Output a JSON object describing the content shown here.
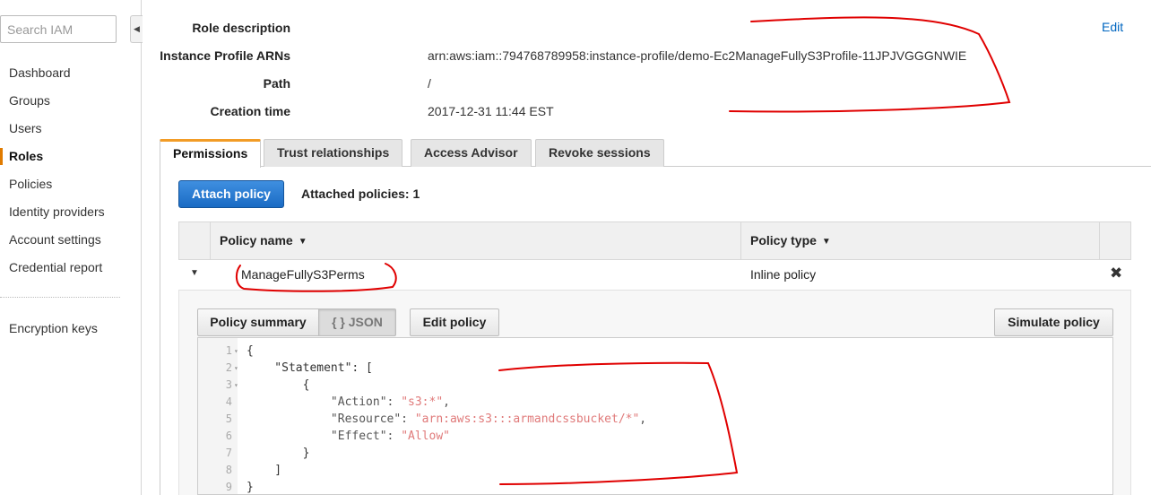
{
  "sidebar": {
    "search_placeholder": "Search IAM",
    "items": [
      {
        "label": "Dashboard"
      },
      {
        "label": "Groups"
      },
      {
        "label": "Users"
      },
      {
        "label": "Roles"
      },
      {
        "label": "Policies"
      },
      {
        "label": "Identity providers"
      },
      {
        "label": "Account settings"
      },
      {
        "label": "Credential report"
      }
    ],
    "active_item": "Roles",
    "extra_item": "Encryption keys"
  },
  "details": {
    "rows": [
      {
        "label": "Role description",
        "value": ""
      },
      {
        "label": "Instance Profile ARNs",
        "value": "arn:aws:iam::794768789958:instance-profile/demo-Ec2ManageFullyS3Profile-11JPJVGGGNWIE"
      },
      {
        "label": "Path",
        "value": "/"
      },
      {
        "label": "Creation time",
        "value": "2017-12-31 11:44 EST"
      }
    ],
    "edit_label": "Edit"
  },
  "tabs": [
    {
      "label": "Permissions",
      "active": true
    },
    {
      "label": "Trust relationships",
      "active": false
    },
    {
      "label": "Access Advisor",
      "active": false
    },
    {
      "label": "Revoke sessions",
      "active": false
    }
  ],
  "permissions": {
    "attach_button": "Attach policy",
    "attached_count_text": "Attached policies: 1",
    "columns": [
      "Policy name",
      "Policy type"
    ],
    "rows": [
      {
        "name": "ManageFullyS3Perms",
        "type": "Inline policy"
      }
    ]
  },
  "policy_view": {
    "summary_button": "Policy summary",
    "json_button": "{ } JSON",
    "edit_button": "Edit policy",
    "simulate_button": "Simulate policy",
    "code_lines": [
      {
        "num": "1",
        "fold": true,
        "text": "{"
      },
      {
        "num": "2",
        "fold": true,
        "text": "    \"Statement\": ["
      },
      {
        "num": "3",
        "fold": true,
        "text": "        {"
      },
      {
        "num": "4",
        "fold": false,
        "text": "            \"Action\": \"s3:*\","
      },
      {
        "num": "5",
        "fold": false,
        "text": "            \"Resource\": \"arn:aws:s3:::armandcssbucket/*\","
      },
      {
        "num": "6",
        "fold": false,
        "text": "            \"Effect\": \"Allow\""
      },
      {
        "num": "7",
        "fold": false,
        "text": "        }"
      },
      {
        "num": "8",
        "fold": false,
        "text": "    ]"
      },
      {
        "num": "9",
        "fold": false,
        "text": "}"
      }
    ]
  },
  "colors": {
    "accent_orange": "#f29c26",
    "primary_blue": "#1a6bc4",
    "link_blue": "#0066c0",
    "annotation_red": "#e00000",
    "json_string": "#e07a7a"
  }
}
